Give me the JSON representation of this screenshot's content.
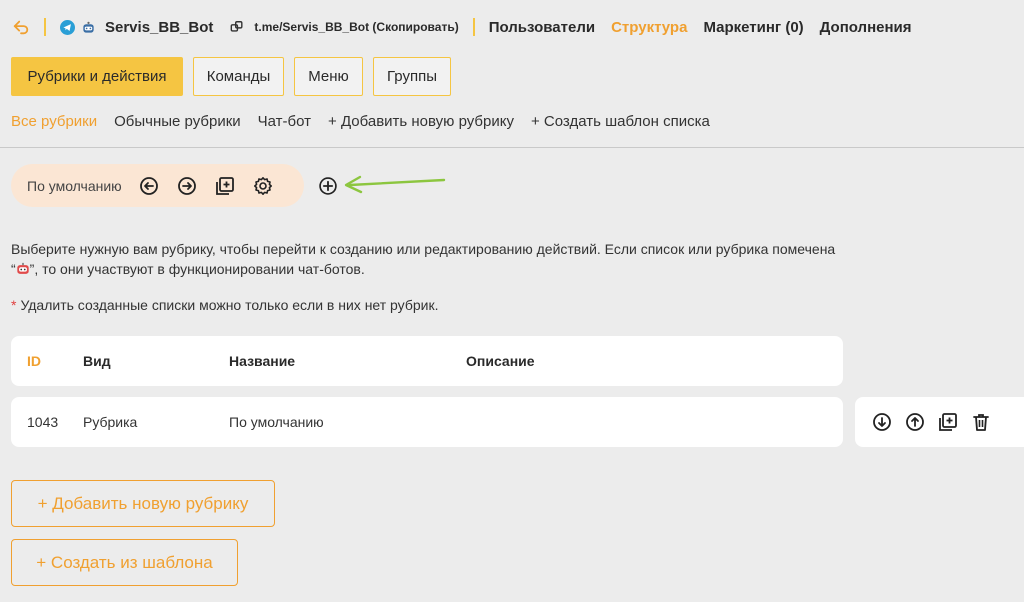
{
  "header": {
    "bot_name": "Servis_BB_Bot",
    "bot_link": "t.me/Servis_BB_Bot (Скопировать)",
    "nav": [
      "Пользователи",
      "Структура",
      "Маркетинг (0)",
      "Дополнения"
    ]
  },
  "tabs": [
    "Рубрики и действия",
    "Команды",
    "Меню",
    "Группы"
  ],
  "filters": [
    "Все рубрики",
    "Обычные рубрики",
    "Чат-бот",
    "+ Добавить новую рубрику",
    "+ Создать шаблон списка"
  ],
  "list_pill": {
    "label": "По умолчанию"
  },
  "info": {
    "line1": "Выберите нужную вам рубрику, чтобы перейти к созданию или редактированию действий. Если список или рубрика помечена",
    "line2_pre": "“",
    "line2_post": "”, то они участвуют в функционировании чат-ботов."
  },
  "note": {
    "star": "*",
    "text": "Удалить созданные списки можно только если в них нет рубрик."
  },
  "table": {
    "headers": [
      "ID",
      "Вид",
      "Название",
      "Описание"
    ],
    "rows": [
      {
        "id": "1043",
        "kind": "Рубрика",
        "name": "По умолчанию",
        "desc": ""
      }
    ]
  },
  "buttons": {
    "add_rubric": "+ Добавить новую рубрику",
    "from_template": "+ Создать из шаблона"
  },
  "colors": {
    "accent": "#f0a030",
    "tab_active": "#f5c542",
    "pill_bg": "#fbe6d4",
    "annotation_arrow": "#8cc63f"
  }
}
